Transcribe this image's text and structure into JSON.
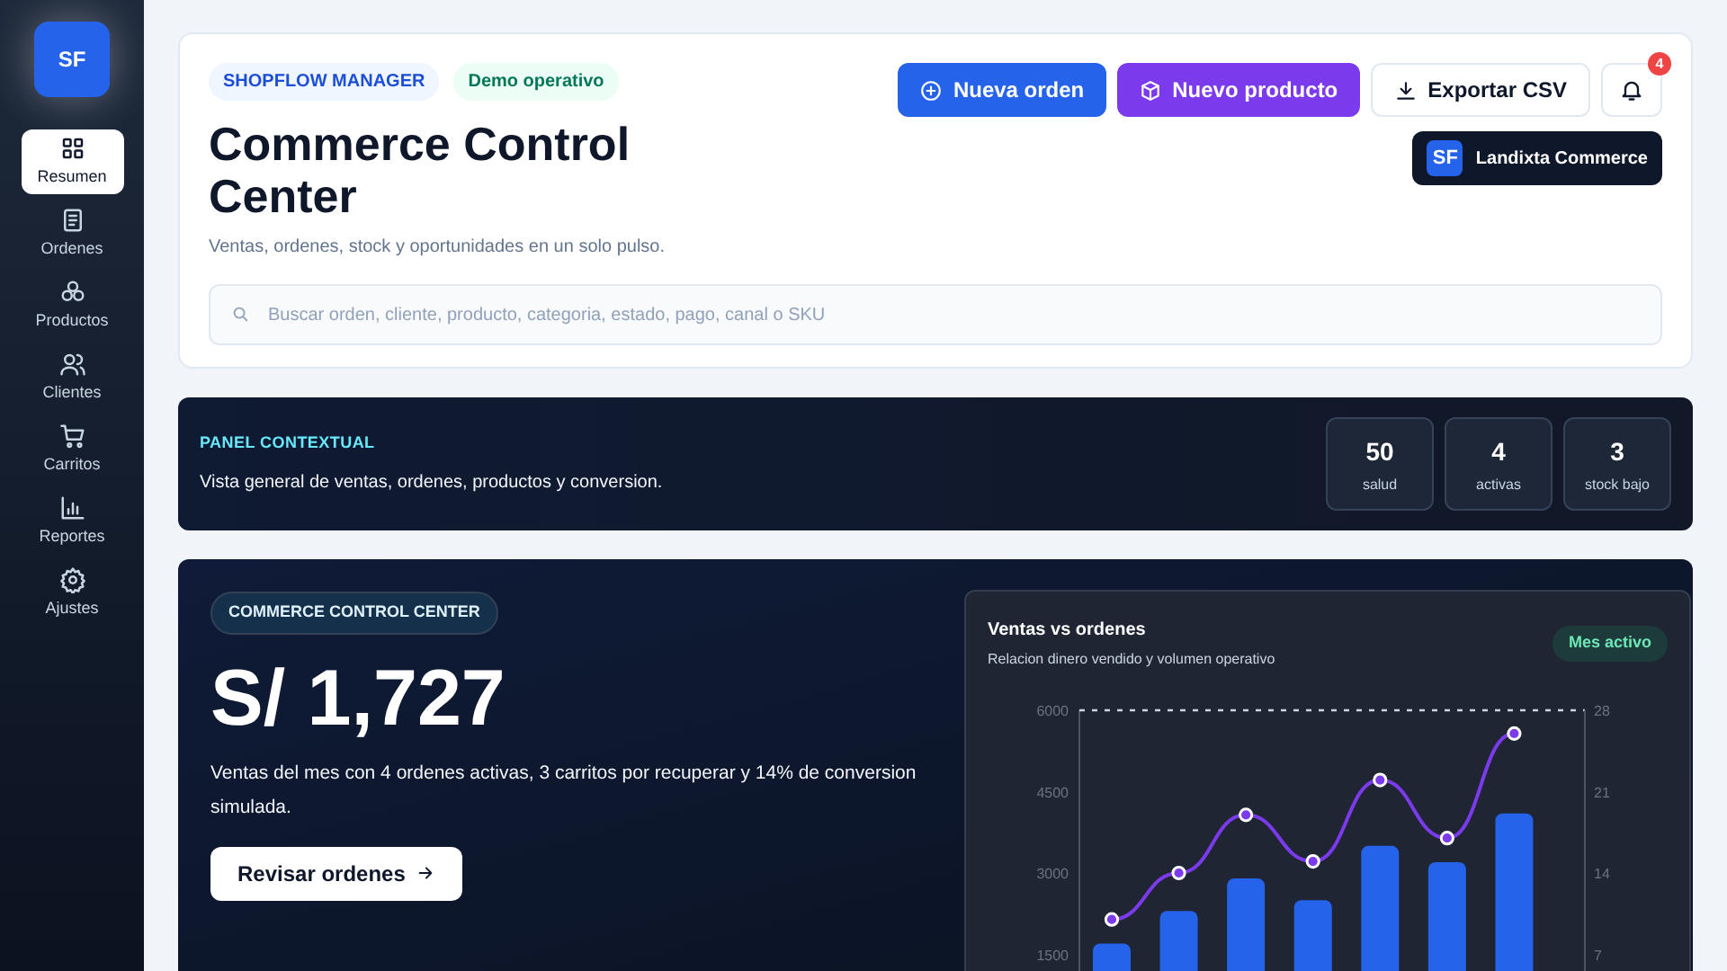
{
  "sidebar": {
    "logo": "SF",
    "items": [
      {
        "label": "Resumen",
        "selected": true
      },
      {
        "label": "Ordenes",
        "selected": false
      },
      {
        "label": "Productos",
        "selected": false
      },
      {
        "label": "Clientes",
        "selected": false
      },
      {
        "label": "Carritos",
        "selected": false
      },
      {
        "label": "Reportes",
        "selected": false
      },
      {
        "label": "Ajustes",
        "selected": false
      }
    ]
  },
  "header": {
    "badges": [
      {
        "label": "SHOPFLOW MANAGER",
        "kind": "brand"
      },
      {
        "label": "Demo operativo",
        "kind": "status"
      }
    ],
    "title": "Commerce Control Center",
    "subtitle": "Ventas, ordenes, stock y oportunidades en un solo pulso.",
    "search": {
      "placeholder": "Buscar orden, cliente, producto, categoria, estado, pago, canal o SKU"
    },
    "buttons": [
      {
        "label": "Nueva orden",
        "kind": "primary"
      },
      {
        "label": "Nuevo producto",
        "kind": "accent"
      },
      {
        "label": "Exportar CSV",
        "kind": "outline"
      }
    ],
    "notifications": {
      "count": "4"
    },
    "account": {
      "initials": "SF",
      "name": "Landixta Commerce"
    }
  },
  "context_panel": {
    "eyebrow": "PANEL CONTEXTUAL",
    "text": "Vista general de ventas, ordenes, productos y conversion.",
    "stats": [
      {
        "value": "50",
        "label": "salud"
      },
      {
        "value": "4",
        "label": "activas"
      },
      {
        "value": "3",
        "label": "stock bajo"
      }
    ]
  },
  "hero": {
    "badge": "COMMERCE CONTROL CENTER",
    "amount": "S/ 1,727",
    "text": "Ventas del mes con 4 ordenes activas, 3 carritos por recuperar y 14% de conversion simulada.",
    "button": "Revisar ordenes",
    "chart": {
      "title": "Ventas vs ordenes",
      "subtitle": "Relacion dinero vendido y volumen operativo",
      "badge": "Mes activo",
      "layers": [
        {
          "chart_data": {
            "type": "bar",
            "ylim": [
              0,
              6000
            ],
            "yticks": [
              1500,
              3000,
              4500,
              6000
            ],
            "series": [
              {
                "color": "#2563eb",
                "values": [
                  1700,
                  2300,
                  2900,
                  2500,
                  3500,
                  3200,
                  4100
                ]
              }
            ]
          }
        },
        {
          "chart_data": {
            "type": "line",
            "ylim": [
              0,
              28
            ],
            "yticks": [
              7,
              14,
              21,
              28
            ],
            "series": [
              {
                "color": "#7c3aed",
                "marker": true,
                "values": [
                  10,
                  14,
                  19,
                  15,
                  22,
                  17,
                  26
                ]
              }
            ]
          }
        }
      ]
    }
  }
}
